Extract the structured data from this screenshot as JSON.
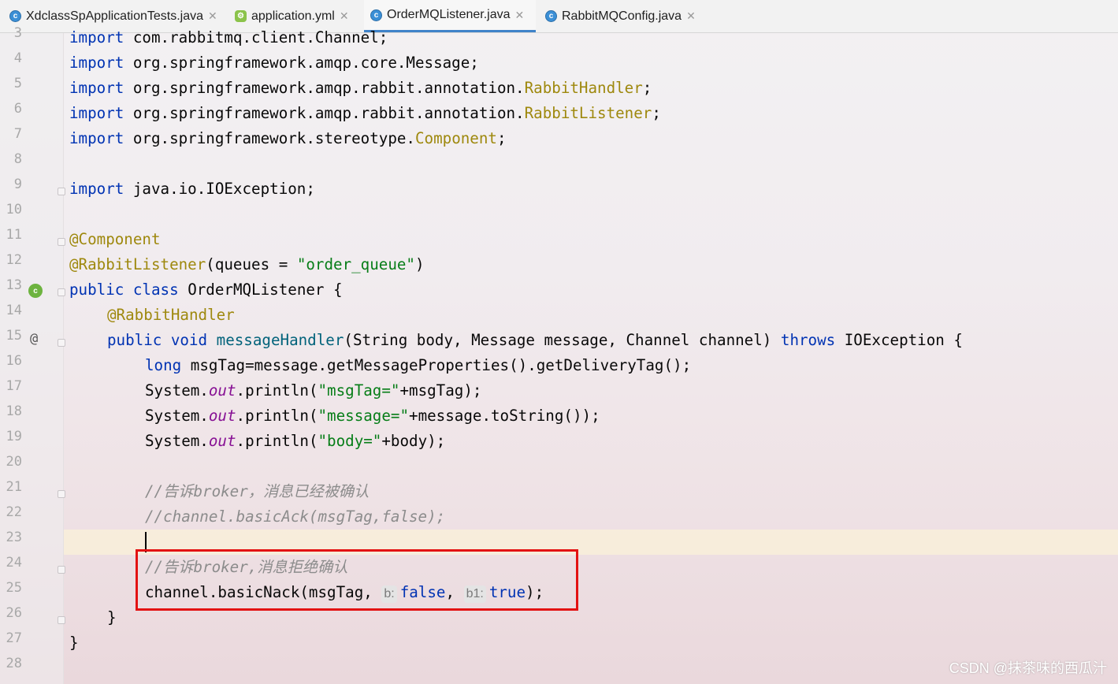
{
  "tabs": [
    {
      "label": "XdclassSpApplicationTests.java",
      "icon": "java-test-class-icon"
    },
    {
      "label": "application.yml",
      "icon": "yml-file-icon"
    },
    {
      "label": "OrderMQListener.java",
      "icon": "java-class-icon",
      "active": true
    },
    {
      "label": "RabbitMQConfig.java",
      "icon": "java-class-icon"
    }
  ],
  "colors": {
    "accent": "#4083c9",
    "keyword": "#0033b3",
    "annotation": "#9e880d",
    "string": "#067d17",
    "highlight_box": "#e31212"
  },
  "line_numbers": [
    "3",
    "4",
    "5",
    "6",
    "7",
    "8",
    "9",
    "10",
    "11",
    "12",
    "13",
    "14",
    "15",
    "16",
    "17",
    "18",
    "19",
    "20",
    "21",
    "22",
    "23",
    "24",
    "25",
    "26",
    "27",
    "28"
  ],
  "code": {
    "l3": {
      "kw": "import",
      "rest": " com.rabbitmq.client.Channel;"
    },
    "l4": {
      "kw": "import",
      "rest": " org.springframework.amqp.core.Message;"
    },
    "l5": {
      "kw": "import",
      "rest": " org.springframework.amqp.rabbit.annotation.",
      "cls": "RabbitHandler",
      "end": ";"
    },
    "l6": {
      "kw": "import",
      "rest": " org.springframework.amqp.rabbit.annotation.",
      "cls": "RabbitListener",
      "end": ";"
    },
    "l7": {
      "kw": "import",
      "rest": " org.springframework.stereotype.",
      "cls": "Component",
      "end": ";"
    },
    "l9": {
      "kw": "import",
      "rest": " java.io.IOException;"
    },
    "l11": {
      "ann": "@Component"
    },
    "l12": {
      "ann": "@RabbitListener",
      "p1": "(queues = ",
      "str": "\"order_queue\"",
      "p2": ")"
    },
    "l13": {
      "kw1": "public",
      "kw2": "class",
      "rest": " OrderMQListener {"
    },
    "l14": {
      "ann": "@RabbitHandler"
    },
    "l15": {
      "kw1": "public",
      "kw2": "void",
      "method": "messageHandler",
      "params": "(String body, Message message, Channel channel) ",
      "kw3": "throws",
      "rest": " IOException {"
    },
    "l16": {
      "kw": "long",
      "rest": " msgTag=message.getMessageProperties().getDeliveryTag();"
    },
    "l17": {
      "a": "System.",
      "field": "out",
      "b": ".println(",
      "str": "\"msgTag=\"",
      "c": "+msgTag);"
    },
    "l18": {
      "a": "System.",
      "field": "out",
      "b": ".println(",
      "str": "\"message=\"",
      "c": "+message.toString());"
    },
    "l19": {
      "a": "System.",
      "field": "out",
      "b": ".println(",
      "str": "\"body=\"",
      "c": "+body);"
    },
    "l21": {
      "cmt": "//告诉broker，消息已经被确认"
    },
    "l22": {
      "cmt": "//channel.basicAck(msgTag,false);"
    },
    "l24": {
      "cmt": "//告诉broker,消息拒绝确认"
    },
    "l25": {
      "a": "channel.basicNack(msgTag, ",
      "hint1": "b:",
      "v1": "false",
      "sep": ", ",
      "hint2": "b1:",
      "v2": "true",
      "end": ");"
    },
    "l26": {
      "text": "}"
    },
    "l27": {
      "text": "}"
    }
  },
  "watermark": "CSDN @抹茶味的西瓜汁"
}
